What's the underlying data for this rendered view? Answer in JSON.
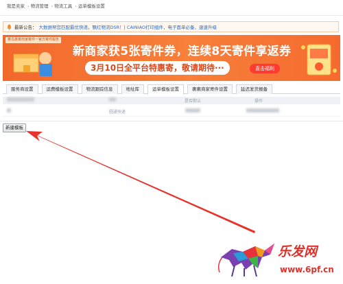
{
  "breadcrumb": {
    "items": [
      "我是卖家",
      "物流管理",
      "物流工具",
      "运单模板设置"
    ],
    "separator": "›"
  },
  "notice": {
    "label": "最新公告：",
    "text": "大数据帮您匹配最优快递，飘红物流DSR！| CAINIAO打印组件，电子面单必备，速速升级"
  },
  "banner": {
    "tag": "菜鸟惠寄商家寄件一官方寄件服务",
    "title": "新商家获5张寄件券，连续8天寄件享返券",
    "subtitle": "3月10日全平台特惠寄，敬请期待···",
    "cta": "直击福利"
  },
  "tabs": [
    {
      "label": "服务商设置",
      "active": false
    },
    {
      "label": "运费模板设置",
      "active": false
    },
    {
      "label": "物流跟踪信息",
      "active": false
    },
    {
      "label": "地址库",
      "active": false
    },
    {
      "label": "运单模板设置",
      "active": true
    },
    {
      "label": "裹裹商家寄件设置",
      "active": false
    },
    {
      "label": "延迟发货报备",
      "active": false
    }
  ],
  "table": {
    "head_right1": "是否默认",
    "head_right2": "操作",
    "row_mid": "圆通快递"
  },
  "new_template_button": "新建模板",
  "watermark": {
    "brand": "乐发网",
    "url": "www.6pf.cn"
  },
  "colors": {
    "banner": "#f56a2f",
    "arrow": "#e8312b",
    "link": "#2a6ac1"
  }
}
